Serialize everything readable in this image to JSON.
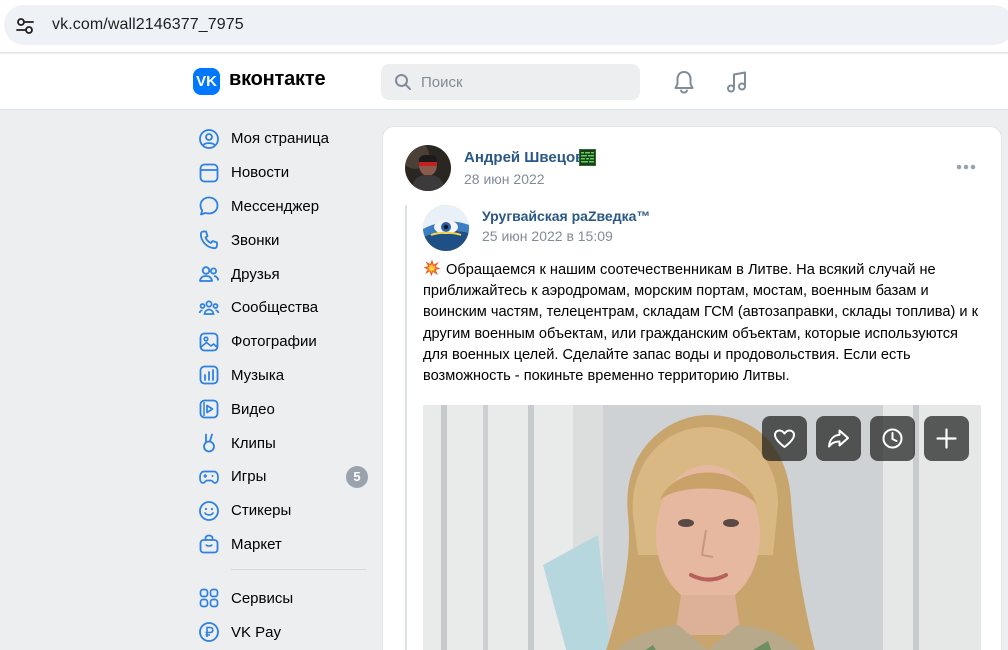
{
  "browser": {
    "url": "vk.com/wall2146377_7975"
  },
  "header": {
    "logo_letters": "VK",
    "brand": "вконтакте",
    "search_placeholder": "Поиск"
  },
  "sidebar": {
    "items": [
      {
        "label": "Моя страница",
        "icon": "user-circle-icon"
      },
      {
        "label": "Новости",
        "icon": "news-icon"
      },
      {
        "label": "Мессенджер",
        "icon": "message-icon"
      },
      {
        "label": "Звонки",
        "icon": "phone-icon"
      },
      {
        "label": "Друзья",
        "icon": "friends-icon"
      },
      {
        "label": "Сообщества",
        "icon": "communities-icon"
      },
      {
        "label": "Фотографии",
        "icon": "photo-icon"
      },
      {
        "label": "Музыка",
        "icon": "music-icon"
      },
      {
        "label": "Видео",
        "icon": "video-icon"
      },
      {
        "label": "Клипы",
        "icon": "clips-icon"
      },
      {
        "label": "Игры",
        "icon": "gamepad-icon",
        "badge": "5"
      },
      {
        "label": "Стикеры",
        "icon": "smile-icon"
      },
      {
        "label": "Маркет",
        "icon": "bag-icon"
      }
    ],
    "extra": [
      {
        "label": "Сервисы",
        "icon": "services-icon"
      },
      {
        "label": "VK Pay",
        "icon": "ruble-icon"
      }
    ]
  },
  "post": {
    "author": "Андрей Швецов",
    "date": "28 июн 2022",
    "repost": {
      "author": "Уругвайская раZведка™",
      "date": "25 июн 2022 в 15:09",
      "text": "Обращаемся к нашим соотечественникам в Литве. На всякий случай не приближайтесь к аэродромам, морским портам, мостам, военным базам и воинским частям, телецентрам, складам ГСМ (автозаправки, склады топлива) и к другим военным объектам, или гражданским объектам, которые используются для военных целей. Сделайте запас воды и продовольствия. Если есть возможность - покиньте временно территорию Литвы."
    },
    "video_actions": [
      "like-icon",
      "share-icon",
      "watch-later-icon",
      "add-icon"
    ]
  },
  "colors": {
    "vk_blue": "#0077ff",
    "link": "#2a5885",
    "muted": "#818c99",
    "page_bg": "#edeef0",
    "badge": "#99a2ad"
  }
}
